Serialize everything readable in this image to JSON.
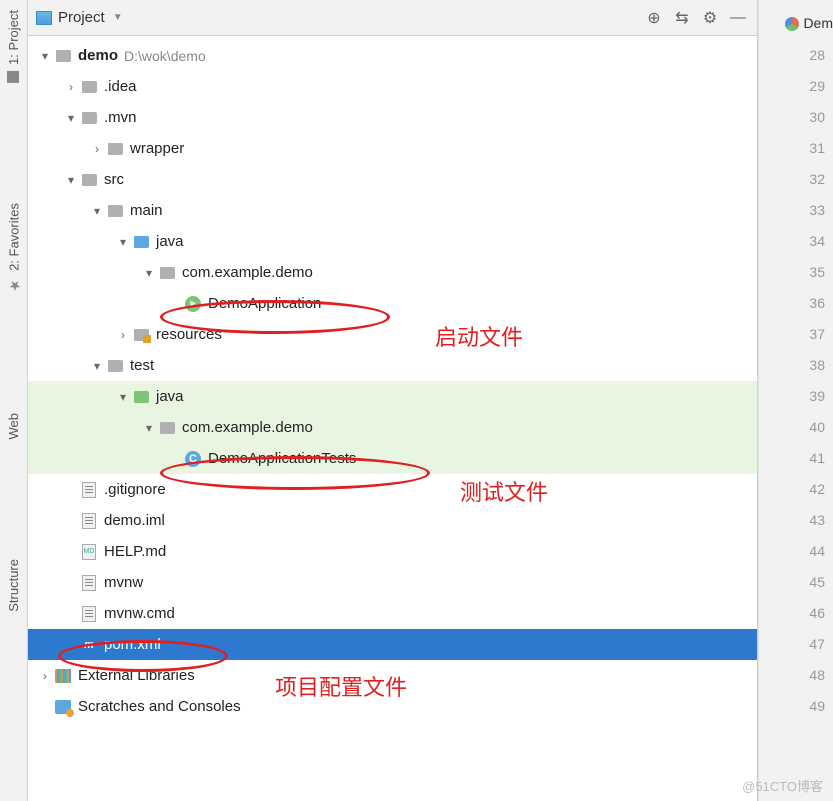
{
  "leftTabs": {
    "project": "1: Project",
    "favorites": "2: Favorites",
    "web": "Web",
    "structure": "Structure"
  },
  "toolbar": {
    "title": "Project"
  },
  "tabRight": "Dem",
  "tree": {
    "root": {
      "name": "demo",
      "path": "D:\\wok\\demo"
    },
    "idea": ".idea",
    "mvn": ".mvn",
    "wrapper": "wrapper",
    "src": "src",
    "main": "main",
    "java": "java",
    "pkg": "com.example.demo",
    "app": "DemoApplication",
    "resources": "resources",
    "test": "test",
    "java2": "java",
    "pkg2": "com.example.demo",
    "appTests": "DemoApplicationTests",
    "gitignore": ".gitignore",
    "iml": "demo.iml",
    "help": "HELP.md",
    "mvnw": "mvnw",
    "mvnwcmd": "mvnw.cmd",
    "pom": "pom.xml",
    "extlib": "External Libraries",
    "scratch": "Scratches and Consoles"
  },
  "lineNumbers": [
    "28",
    "29",
    "30",
    "31",
    "32",
    "33",
    "34",
    "35",
    "36",
    "37",
    "38",
    "39",
    "40",
    "41",
    "42",
    "43",
    "44",
    "45",
    "46",
    "47",
    "48",
    "49"
  ],
  "annotations": {
    "startFile": "启动文件",
    "testFile": "测试文件",
    "configFile": "项目配置文件"
  },
  "watermark": "@51CTO博客"
}
